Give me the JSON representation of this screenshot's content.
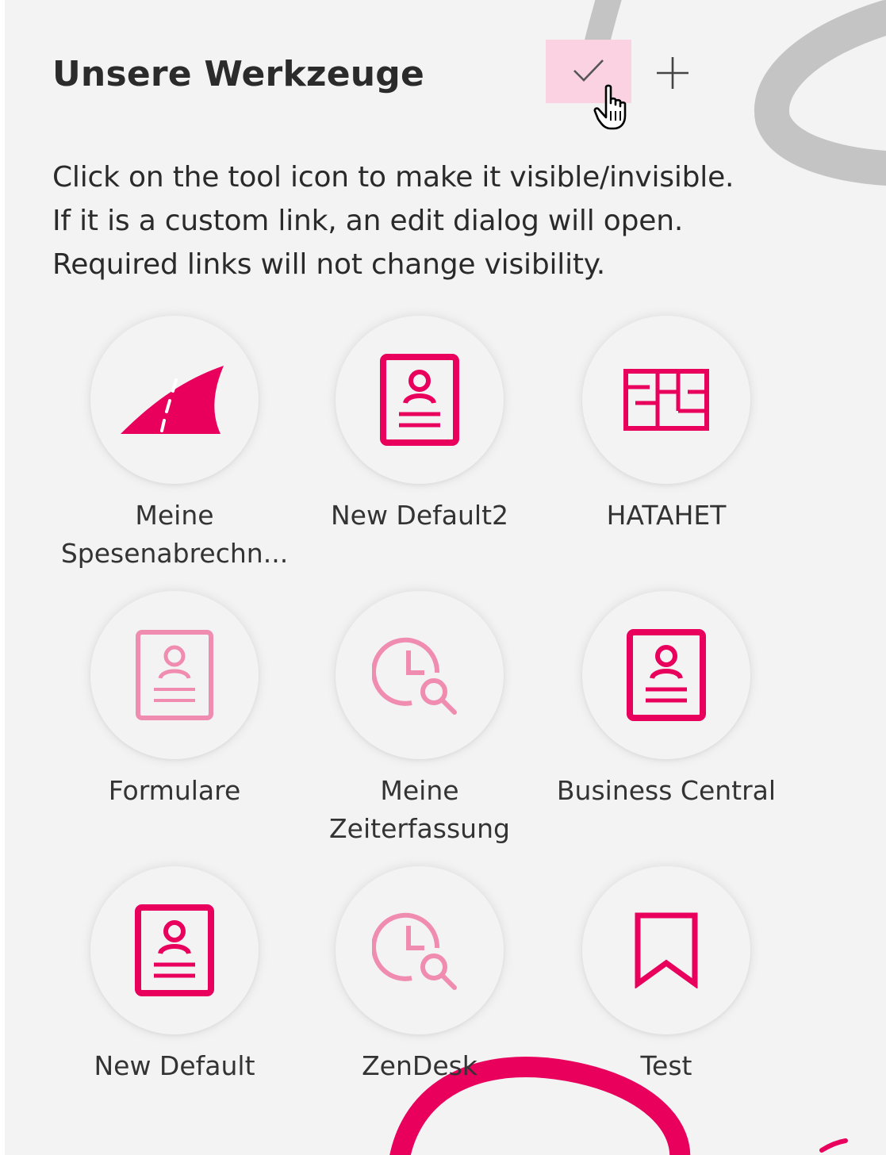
{
  "colors": {
    "accent": "#e8005c",
    "accent_faded": "#f08cb0",
    "check_highlight": "#fbd2e2",
    "panel_background": "#f3f3f3",
    "deco_gray": "#c6c6c6"
  },
  "header": {
    "title": "Unsere Werkzeuge",
    "check_icon": "checkmark-icon",
    "plus_icon": "plus-icon"
  },
  "instructions": [
    "Click on the tool icon to make it visible/invisible.",
    "If it is a custom link, an edit dialog will open.",
    "Required links will not change visibility."
  ],
  "tools": [
    {
      "label": "Meine Spesenabrechn...",
      "icon": "road-icon",
      "visible": true
    },
    {
      "label": "New Default2",
      "icon": "contact-card-icon",
      "visible": true
    },
    {
      "label": "HATAHET",
      "icon": "floor-plan-icon",
      "visible": true
    },
    {
      "label": "Formulare",
      "icon": "contact-card-icon",
      "visible": false
    },
    {
      "label": "Meine Zeiterfassung",
      "icon": "clock-search-icon",
      "visible": false
    },
    {
      "label": "Business Central",
      "icon": "contact-card-icon",
      "visible": true
    },
    {
      "label": "New Default",
      "icon": "contact-card-icon",
      "visible": true
    },
    {
      "label": "ZenDesk",
      "icon": "clock-search-icon",
      "visible": false
    },
    {
      "label": "Test",
      "icon": "bookmark-icon",
      "visible": true
    }
  ]
}
